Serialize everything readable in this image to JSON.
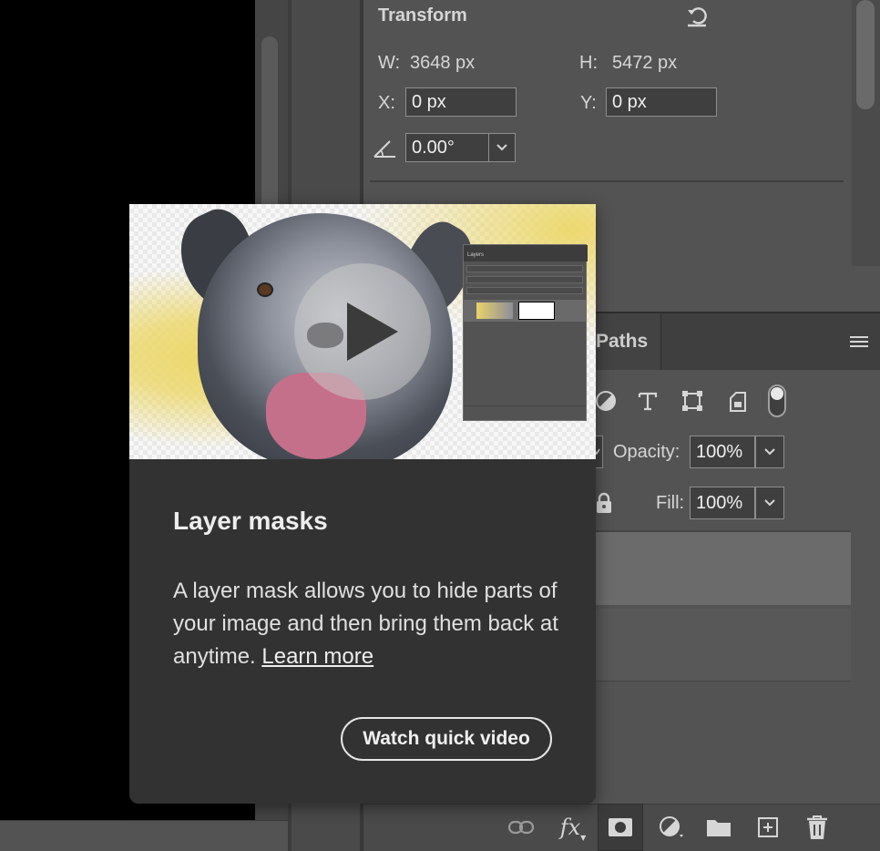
{
  "properties": {
    "section_title": "Transform",
    "reset_icon": "reset-icon",
    "width_label": "W:",
    "width_value": "3648 px",
    "height_label": "H:",
    "height_value": "5472 px",
    "x_label": "X:",
    "x_value": "0 px",
    "y_label": "Y:",
    "y_value": "0 px",
    "angle_icon": "angle-icon",
    "angle_value": "0.00°"
  },
  "layers_panel": {
    "tab_paths": "Paths",
    "opacity_label": "Opacity:",
    "opacity_value": "100%",
    "fill_label": "Fill:",
    "fill_value": "100%",
    "filter_icons": [
      "adjustment-filter-icon",
      "type-filter-icon",
      "shape-filter-icon",
      "smart-object-filter-icon",
      "filter-toggle-icon"
    ],
    "bottom_icons": [
      "link-layers-icon",
      "fx-icon",
      "add-mask-icon",
      "new-fill-adjustment-icon",
      "new-group-icon",
      "new-layer-icon",
      "delete-layer-icon"
    ],
    "fx_label": "fx"
  },
  "popup": {
    "title": "Layer masks",
    "body": "A layer mask allows you to hide parts of your image and then bring them back at anytime.",
    "link": "Learn more",
    "button": "Watch quick video",
    "mini_panel_title": "Layers"
  },
  "colors": {
    "panel_bg": "#535353",
    "popup_bg": "#323232",
    "canvas_bg": "#000000"
  }
}
